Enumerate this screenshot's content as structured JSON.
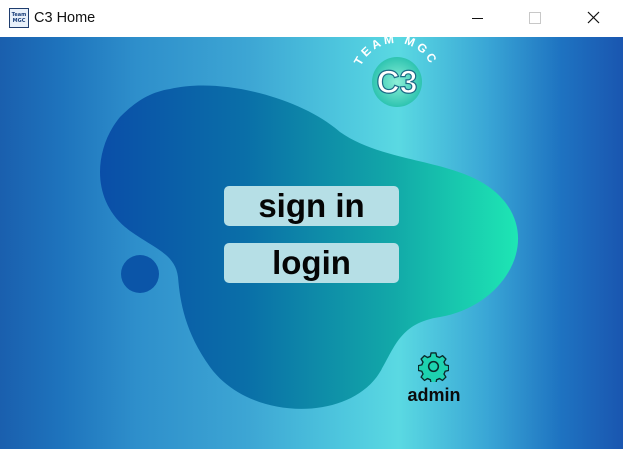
{
  "window": {
    "title": "C3 Home",
    "icon_text_line1": "Team",
    "icon_text_line2": "MGC"
  },
  "logo": {
    "arc_text": "TEAM MGC",
    "center_text": "C3"
  },
  "buttons": {
    "sign_in": "sign in",
    "login": "login"
  },
  "admin": {
    "label": "admin",
    "icon": "gear-icon"
  },
  "colors": {
    "blob_start": "#0a4ea8",
    "blob_end": "#1ee6b4",
    "button_bg": "#b6dfe6",
    "gear_fill": "#1dd3b0"
  }
}
